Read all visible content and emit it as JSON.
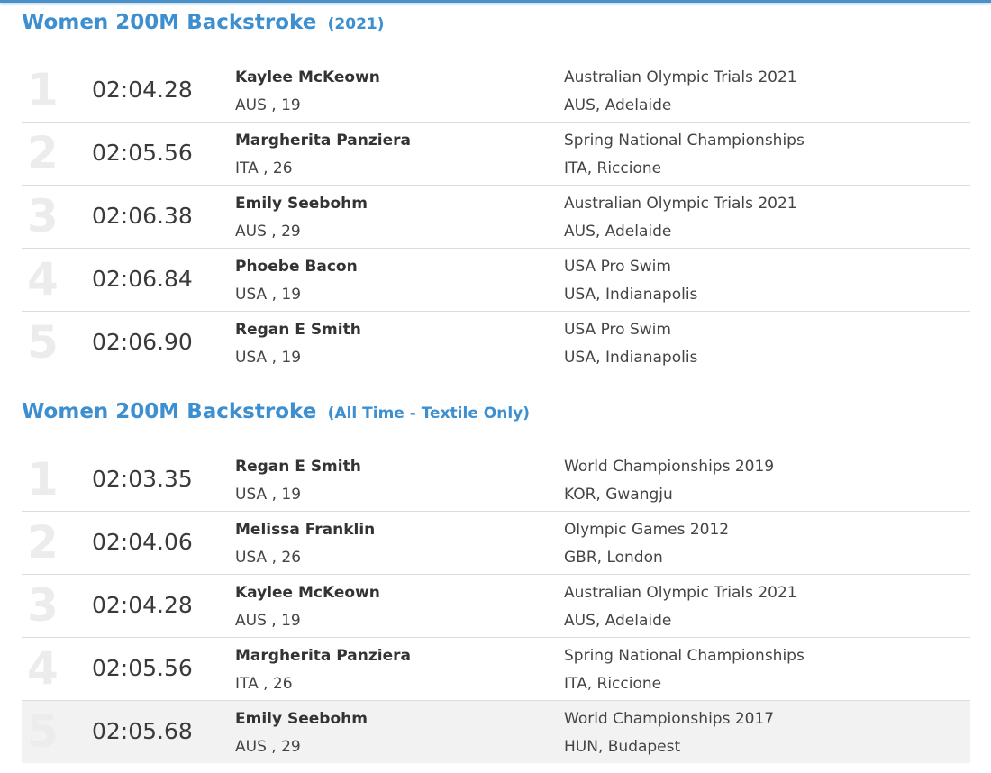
{
  "colors": {
    "accent": "#3d8fd0",
    "rank_numeral": "#ececec",
    "row_divider": "#dcdcdc",
    "highlight_row": "#f2f2f2"
  },
  "sections": [
    {
      "title": "Women 200M Backstroke",
      "subtitle": "(2021)",
      "rows": [
        {
          "rank": "1",
          "time": "02:04.28",
          "name": "Kaylee McKeown",
          "country_age": "AUS , 19",
          "meet": "Australian Olympic Trials 2021",
          "location": "AUS, Adelaide"
        },
        {
          "rank": "2",
          "time": "02:05.56",
          "name": "Margherita Panziera",
          "country_age": "ITA , 26",
          "meet": "Spring National Championships",
          "location": "ITA, Riccione"
        },
        {
          "rank": "3",
          "time": "02:06.38",
          "name": "Emily Seebohm",
          "country_age": "AUS , 29",
          "meet": "Australian Olympic Trials 2021",
          "location": "AUS, Adelaide"
        },
        {
          "rank": "4",
          "time": "02:06.84",
          "name": "Phoebe Bacon",
          "country_age": "USA , 19",
          "meet": "USA Pro Swim",
          "location": "USA, Indianapolis"
        },
        {
          "rank": "5",
          "time": "02:06.90",
          "name": "Regan E Smith",
          "country_age": "USA , 19",
          "meet": "USA Pro Swim",
          "location": "USA, Indianapolis"
        }
      ]
    },
    {
      "title": "Women 200M Backstroke",
      "subtitle": "(All Time - Textile Only)",
      "rows": [
        {
          "rank": "1",
          "time": "02:03.35",
          "name": "Regan E Smith",
          "country_age": "USA , 19",
          "meet": "World Championships 2019",
          "location": "KOR, Gwangju"
        },
        {
          "rank": "2",
          "time": "02:04.06",
          "name": "Melissa Franklin",
          "country_age": "USA , 26",
          "meet": "Olympic Games 2012",
          "location": "GBR, London"
        },
        {
          "rank": "3",
          "time": "02:04.28",
          "name": "Kaylee McKeown",
          "country_age": "AUS , 19",
          "meet": "Australian Olympic Trials 2021",
          "location": "AUS, Adelaide"
        },
        {
          "rank": "4",
          "time": "02:05.56",
          "name": "Margherita Panziera",
          "country_age": "ITA , 26",
          "meet": "Spring National Championships",
          "location": "ITA, Riccione"
        },
        {
          "rank": "5",
          "time": "02:05.68",
          "name": "Emily Seebohm",
          "country_age": "AUS , 29",
          "meet": "World Championships 2017",
          "location": "HUN, Budapest"
        }
      ]
    }
  ]
}
